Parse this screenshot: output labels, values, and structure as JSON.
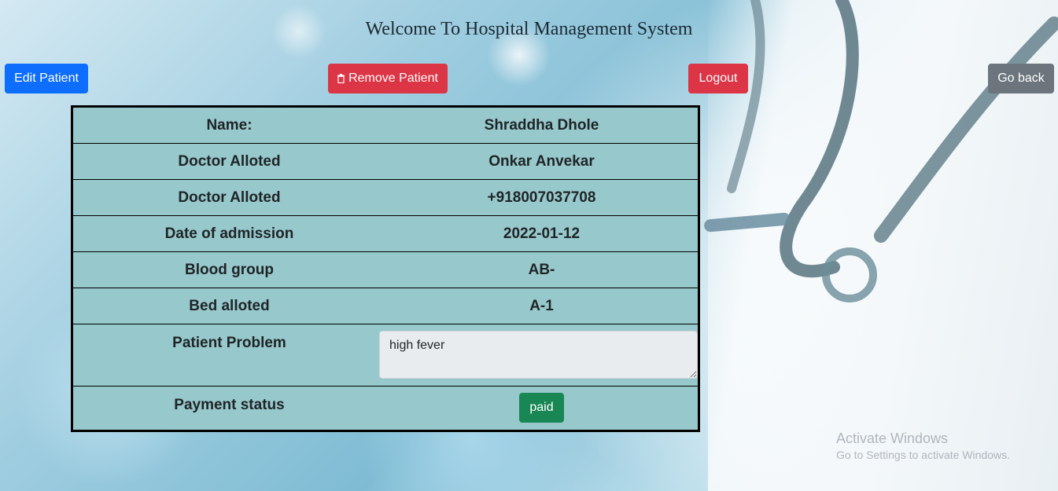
{
  "header": {
    "title": "Welcome To Hospital Management System"
  },
  "toolbar": {
    "edit_label": "Edit Patient",
    "remove_label": "Remove Patient",
    "logout_label": "Logout",
    "back_label": "Go back"
  },
  "patient": {
    "rows": [
      {
        "label": "Name:",
        "value": "Shraddha Dhole"
      },
      {
        "label": "Doctor Alloted",
        "value": "Onkar Anvekar"
      },
      {
        "label": "Doctor Alloted",
        "value": "+918007037708"
      },
      {
        "label": "Date of admission",
        "value": "2022-01-12"
      },
      {
        "label": "Blood group",
        "value": "AB-"
      },
      {
        "label": "Bed alloted",
        "value": "A-1"
      }
    ],
    "problem_label": "Patient Problem",
    "problem_value": "high fever",
    "payment_label": "Payment status",
    "payment_value": "paid"
  },
  "watermark": {
    "line1": "Activate Windows",
    "line2": "Go to Settings to activate Windows."
  },
  "colors": {
    "primary": "#0d6efd",
    "danger": "#dc3545",
    "secondary": "#6c757d",
    "success": "#198754",
    "table_bg": "#97c8cb"
  }
}
